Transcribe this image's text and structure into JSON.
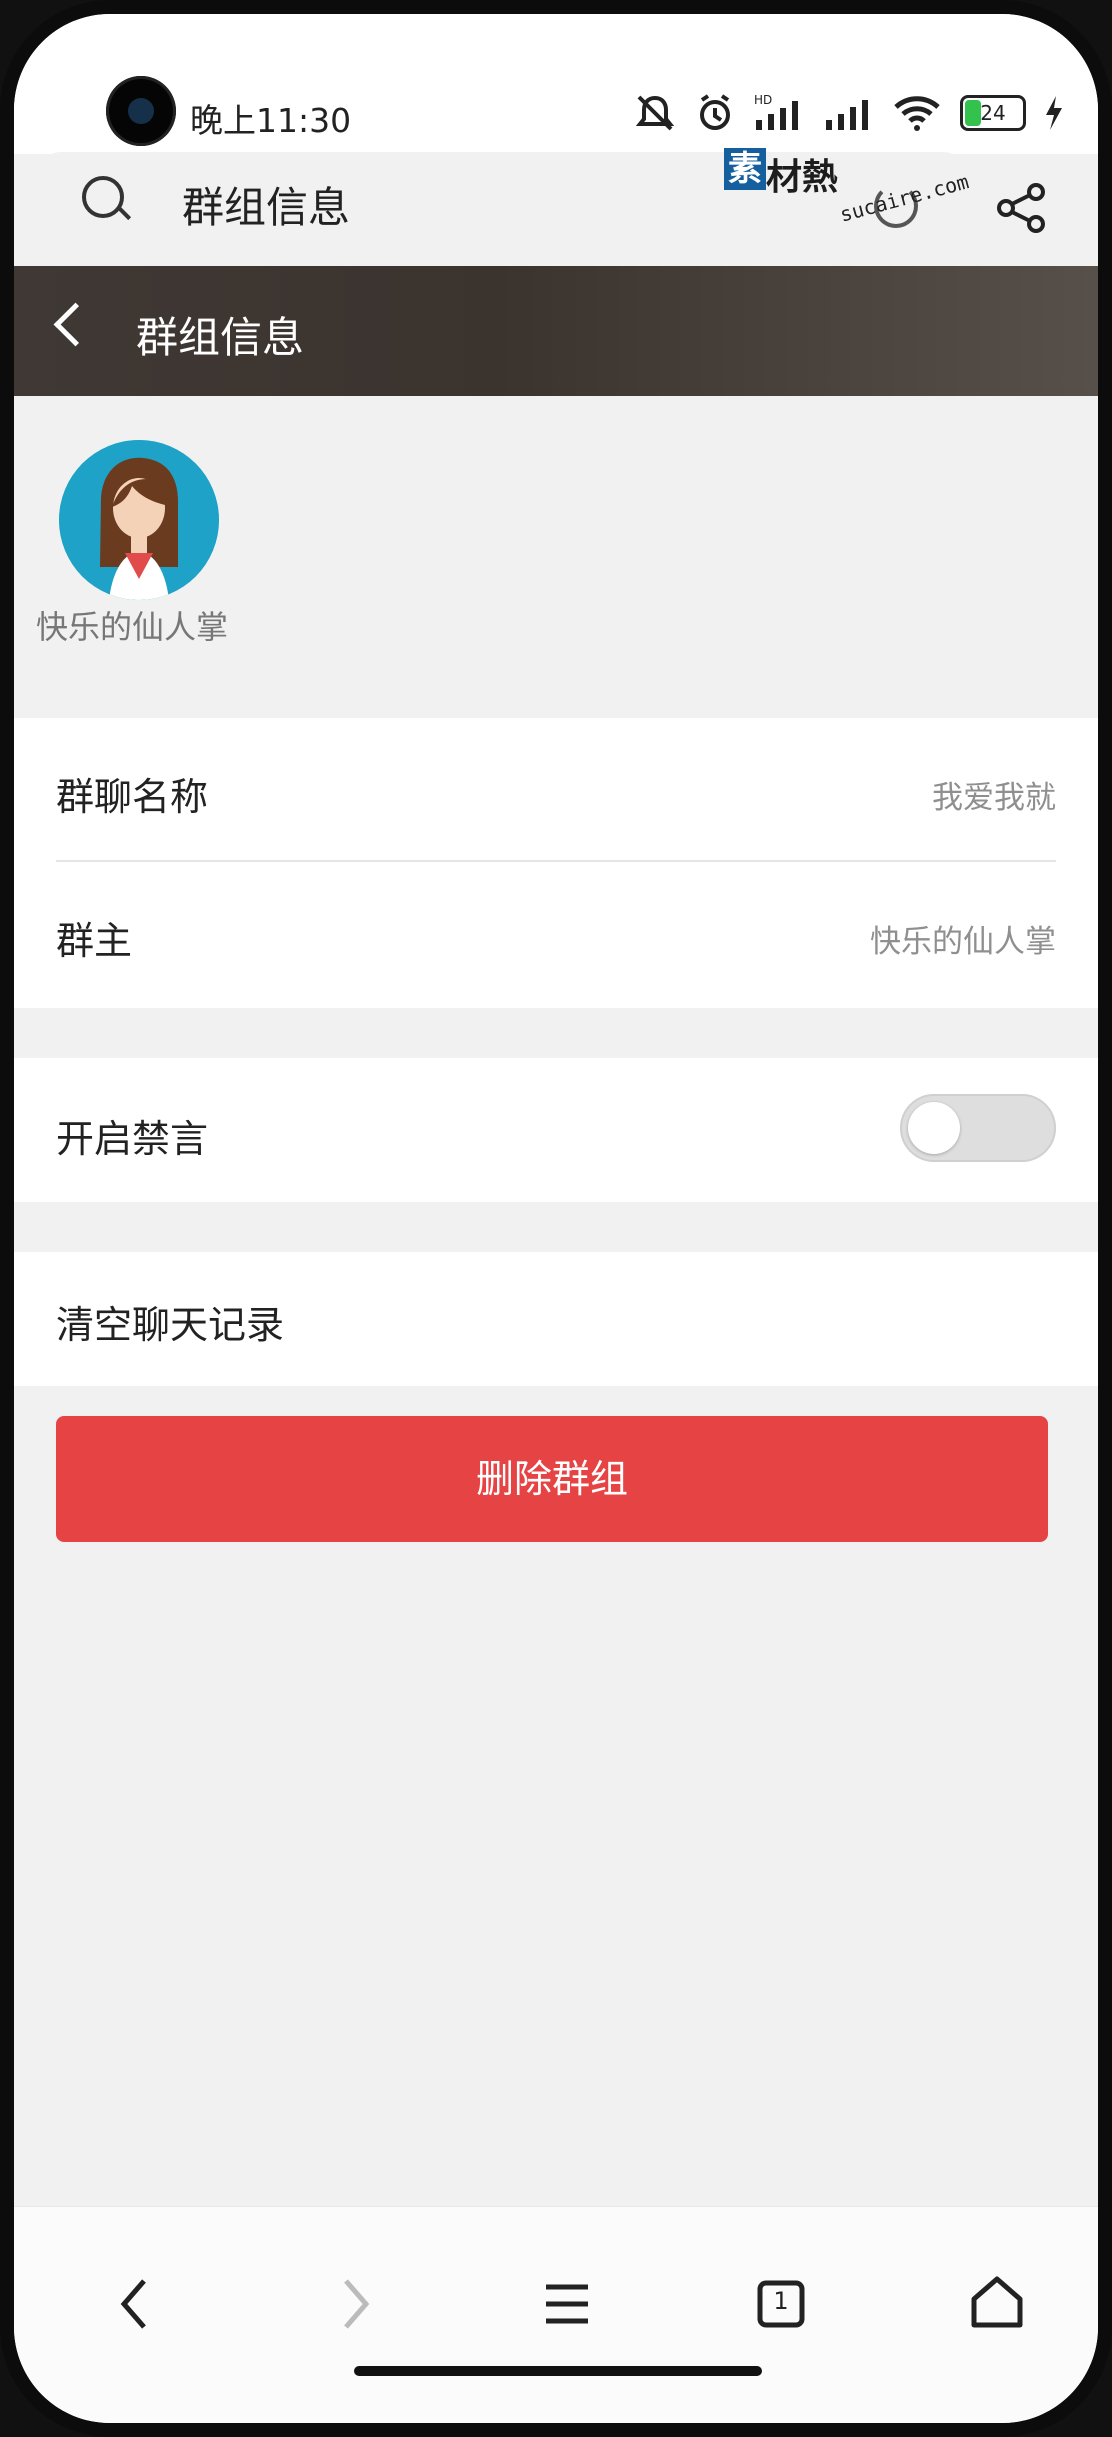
{
  "status_bar": {
    "time": "晚上11:30",
    "battery": "24"
  },
  "browser": {
    "search_text": "群组信息",
    "watermark": {
      "logo_char": "素",
      "text": "材熱",
      "url": "sucaire.com"
    }
  },
  "header": {
    "title": "群组信息"
  },
  "member": {
    "name": "快乐的仙人掌"
  },
  "rows": {
    "group_name_label": "群聊名称",
    "group_name_value": "我爱我就",
    "owner_label": "群主",
    "owner_value": "快乐的仙人掌",
    "mute_label": "开启禁言",
    "clear_label": "清空聊天记录"
  },
  "buttons": {
    "delete_label": "删除群组"
  },
  "bottom_nav": {
    "tabs_count": "1"
  },
  "colors": {
    "header": "#3f3834",
    "delete": "#e64444",
    "avatar_bg": "#1ea2c8"
  }
}
